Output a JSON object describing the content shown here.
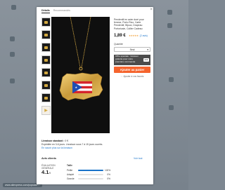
{
  "tabs": [
    {
      "label": "Détails",
      "active": true
    },
    {
      "label": "Recommandés",
      "active": false
    }
  ],
  "product": {
    "title": "Pendentif en acier doré pour femme, Porto Rico, Carte Pendentif, Bijoux, Drapeau Portoricain, Collier Cadeau",
    "price": "1,89 €",
    "rating_stars": "★★★★★",
    "rating_count": "(2 avis)",
    "quantity_label": "Quantité",
    "quantity_value": "Seul",
    "add_to_cart": "Ajouter au panier",
    "wishlist": "Ajouter à vos favoris"
  },
  "promo": {
    "text": "Offre spéciale : livraison gratuite pour votre première commande",
    "button": "Voir"
  },
  "delivery": {
    "line1_label": "Livraison standard :",
    "line1_value": "0 €",
    "line2": "Expédiée en 3-6 jours. Livraison sous 7 à 15 jours ouvrés.",
    "link": "En savoir plus sur la livraison"
  },
  "reviews": {
    "heading": "Avis clients",
    "see_all": "Voir tout",
    "score_caption": "ÉVALUATION GÉNÉRALE",
    "score": "4.1",
    "score_max": "/5",
    "dist_header": "Taille",
    "dist": [
      {
        "label": "Petite",
        "pct": 100
      },
      {
        "label": "Adapté",
        "pct": 0
      },
      {
        "label": "Grande",
        "pct": 0
      }
    ]
  },
  "background": {
    "link": "www.aliexpress.com/popular/..."
  },
  "colors": {
    "accent": "#f5642d",
    "link": "#1a73c9",
    "stars": "#f0a13a",
    "promo_bg": "#4c4c4c"
  }
}
